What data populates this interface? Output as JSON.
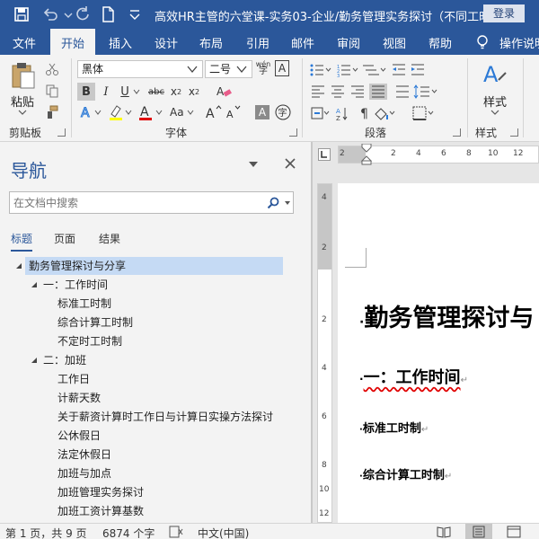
{
  "titlebar": {
    "title": "高效HR主管的六堂课-实务03-企业/勤务管理实务探讨（不同工时...",
    "login_label": "登录"
  },
  "ribbon_tabs": [
    {
      "label": "文件"
    },
    {
      "label": "开始"
    },
    {
      "label": "插入"
    },
    {
      "label": "设计"
    },
    {
      "label": "布局"
    },
    {
      "label": "引用"
    },
    {
      "label": "邮件"
    },
    {
      "label": "审阅"
    },
    {
      "label": "视图"
    },
    {
      "label": "帮助"
    },
    {
      "label": "操作说明"
    }
  ],
  "ribbon": {
    "paste_label": "粘贴",
    "font_name": "黑体",
    "font_size": "二号",
    "styles_label": "样式",
    "group_clipboard": "剪贴板",
    "group_font": "字体",
    "group_paragraph": "段落",
    "group_styles": "样式",
    "pinyin_glyph": "wén",
    "enclose_glyph": "字"
  },
  "nav": {
    "title": "导航",
    "search_placeholder": "在文档中搜索",
    "tabs": [
      {
        "label": "标题"
      },
      {
        "label": "页面"
      },
      {
        "label": "结果"
      }
    ],
    "headings": [
      {
        "text": "勤务管理探讨与分享"
      },
      {
        "text": "一：工作时间"
      },
      {
        "text": "标准工时制"
      },
      {
        "text": "综合计算工时制"
      },
      {
        "text": "不定时工时制"
      },
      {
        "text": "二：加班"
      },
      {
        "text": "工作日"
      },
      {
        "text": "计薪天数"
      },
      {
        "text": "关于薪资计算时工作日与计算日实操方法探讨"
      },
      {
        "text": "公休假日"
      },
      {
        "text": "法定休假日"
      },
      {
        "text": "加班与加点"
      },
      {
        "text": "加班管理实务探讨"
      },
      {
        "text": "加班工资计算基数"
      }
    ]
  },
  "ruler": {
    "h_numbers": [
      "2",
      "2",
      "4",
      "6",
      "8",
      "10",
      "12"
    ],
    "v_numbers": [
      "4",
      "2",
      "2",
      "4",
      "6",
      "8",
      "10",
      "12"
    ]
  },
  "document": {
    "title": "勤务管理探讨与",
    "heading1": "一：工作时间",
    "sub1": "标准工时制",
    "sub2": "综合计算工时制",
    "para_mark": "↵"
  },
  "status": {
    "page": "第 1 页，共 9 页",
    "words": "6874 个字",
    "language": "中文(中国)"
  }
}
